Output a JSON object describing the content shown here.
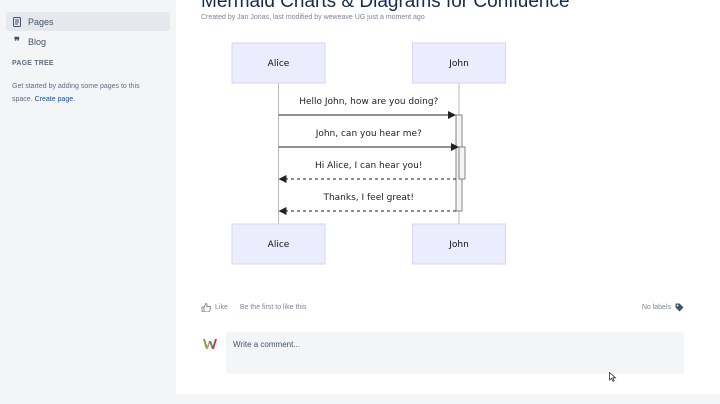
{
  "sidebar": {
    "items": [
      {
        "label": "Pages",
        "icon": "page-icon",
        "active": true
      },
      {
        "label": "Blog",
        "icon": "quote-icon",
        "active": false
      }
    ],
    "page_tree": {
      "title": "PAGE TREE",
      "text": "Get started by adding some pages to this space.",
      "link": "Create page."
    }
  },
  "page": {
    "title": "Mermaid Charts & Diagrams for Confluence",
    "byline": "Created by Jan Jonas, last modified by weweave UG just a moment ago"
  },
  "diagram": {
    "type": "sequence",
    "actors": [
      "Alice",
      "John"
    ],
    "messages": [
      {
        "from": "Alice",
        "to": "John",
        "text": "Hello John, how are you doing?",
        "style": "solid"
      },
      {
        "from": "Alice",
        "to": "John",
        "text": "John, can you hear me?",
        "style": "solid"
      },
      {
        "from": "John",
        "to": "Alice",
        "text": "Hi Alice, I can hear you!",
        "style": "dashed"
      },
      {
        "from": "John",
        "to": "Alice",
        "text": "Thanks, I feel great!",
        "style": "dashed"
      }
    ]
  },
  "footer": {
    "like_label": "Like",
    "like_prompt": "Be the first to like this",
    "labels_text": "No labels",
    "comment_placeholder": "Write a comment...",
    "colors": {
      "link": "#0052cc",
      "actor_fill": "#ececff",
      "muted_text": "#7a869a"
    }
  }
}
